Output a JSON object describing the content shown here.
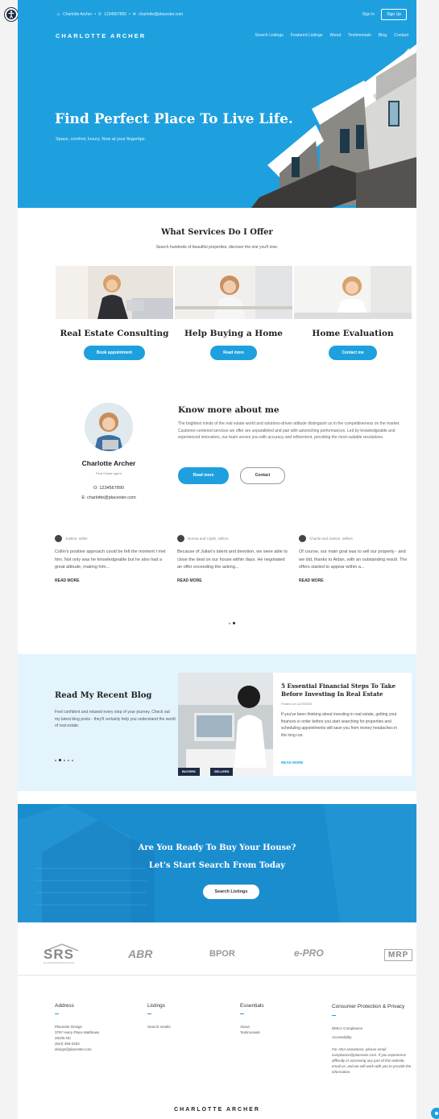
{
  "topbar": {
    "name": "Charlotte Archer",
    "separator1": "•",
    "phone": "1234567890",
    "separator2": "•",
    "email": "charlotte@placester.com",
    "sign_in": "Sign In",
    "sign_up": "Sign Up"
  },
  "header": {
    "brand": "CHARLOTTE ARCHER",
    "nav": [
      "Search Listings",
      "Featured Listings",
      "About",
      "Testimonials",
      "Blog",
      "Contact"
    ]
  },
  "hero": {
    "title": "Find Perfect Place To Live Life.",
    "subtitle": "Space, comfort, luxury. Now at your fingertips."
  },
  "services": {
    "title": "What Services Do I Offer",
    "subtitle": "Search hundreds of beautiful properties, discover the one you'll love.",
    "items": [
      {
        "name": "Real Estate Consulting",
        "button": "Book appointment"
      },
      {
        "name": "Help Buying a Home",
        "button": "Read more"
      },
      {
        "name": "Home Evaluation",
        "button": "Contact me"
      }
    ]
  },
  "about": {
    "agent_name": "Charlotte Archer",
    "agent_role": "Real Estate agent",
    "phone": "O: 1234567890",
    "email": "E: charlotte@placester.com",
    "title": "Know more about me",
    "text": "The brightest minds of the real estate world and solutions-driven attitude distinguish us in the competitiveness on the market. Customer-centered services we offer are unparalleled and pair with astonishing performances. Led by knowledgeable and experienced innovators, our team serves you with accuracy and refinement, providing the most suitable resolutions.",
    "read_more": "Read more",
    "contact": "Contact"
  },
  "testimonials": [
    {
      "author": "Justine, seller",
      "text": "Collin's positive approach could be felt the moment I met him. Not only was he knowledgeable but he also had a great attitude, making him...",
      "more": "READ MORE"
    },
    {
      "author": "Norma and Clyde, sellers",
      "text": "Because of Julian's talent and devotion, we were able to close the deal on our house within days. He negotiated an offer exceeding the asking...",
      "more": "READ MORE"
    },
    {
      "author": "Charlie and Justice, sellers",
      "text": "Of course, our main goal was to sell our property - and we did, thanks to Aidan, with an outstanding result. The offers started to appear within a...",
      "more": "READ MORE"
    }
  ],
  "blog": {
    "title": "Read My Recent Blog",
    "text": "Feel confident and relaxed every step of your journey. Check out my latest blog posts - they'll certainly help you understand the world of real estate.",
    "post": {
      "tags": [
        "BUYERS",
        "SELLERS"
      ],
      "title": "5 Essential Financial Steps To Take Before Investing In Real Estate",
      "date": "Posted on 11/23/2021",
      "text": "If you've been thinking about investing in real estate, getting your finances in order before you start searching for properties and scheduling appointments will save you from money headaches in the long run.",
      "more": "READ MORE"
    }
  },
  "cta": {
    "line1": "Are You Ready To Buy Your House?",
    "line2": "Let's Start Search From Today",
    "button": "Search Listings"
  },
  "logos": [
    "SRS",
    "ABR",
    "BPOR",
    "e-PRO",
    "MRP"
  ],
  "logo_subtitle": "SELLER REPRESENTATIVE SPECIALIST",
  "footer": {
    "columns": [
      {
        "head": "Address",
        "lines": [
          "Placester Design",
          "3797 Harry Place Matthews",
          "28105 NC",
          "(644) 456-2254",
          "design@placester.com"
        ]
      },
      {
        "head": "Listings",
        "lines": [
          "Search results"
        ]
      },
      {
        "head": "Essentials",
        "lines": [
          "About",
          "Testimonials"
        ]
      },
      {
        "head": "Consumer Protection & Privacy",
        "lines": [
          "DMCA Compliance",
          "Accessibility"
        ],
        "note": "For ADA assistance, please email compliance@placester.com. If you experience difficulty in accessing any part of this website, email us, and we will work with you to provide the information."
      }
    ],
    "brand": "CHARLOTTE ARCHER"
  },
  "colors": {
    "accent": "#1ea0df",
    "dark": "#1c2a45",
    "blog_bg": "#e3f4fc"
  }
}
